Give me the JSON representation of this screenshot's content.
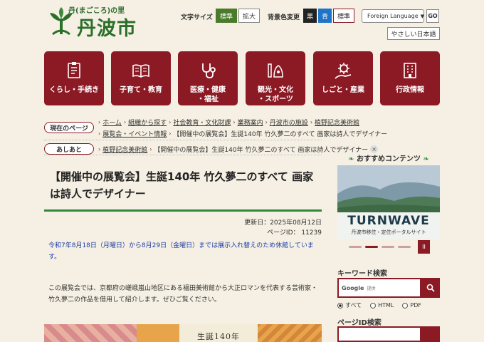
{
  "header": {
    "logo_sub": "丹(まごころ)の里",
    "logo_main": "丹波市",
    "font_size_label": "文字サイズ",
    "font_normal": "標準",
    "font_large": "拡大",
    "bg_label": "背景色変更",
    "bg_black": "黒",
    "bg_blue": "青",
    "bg_normal": "標準",
    "language": "Foreign Language",
    "go": "GO",
    "easy_japanese": "やさしい日本語"
  },
  "nav": [
    {
      "label": "くらし・手続き",
      "icon": "document-icon"
    },
    {
      "label": "子育て・教育",
      "icon": "book-icon"
    },
    {
      "label": "医療・健康\n・福祉",
      "icon": "stethoscope-icon"
    },
    {
      "label": "観光・文化\n・スポーツ",
      "icon": "art-icon"
    },
    {
      "label": "しごと・産業",
      "icon": "gear-hand-icon"
    },
    {
      "label": "行政情報",
      "icon": "building-icon"
    }
  ],
  "breadcrumb": {
    "current_label": "現在のページ",
    "row1": [
      "ホーム",
      "組織から探す",
      "社会教育・文化財課",
      "業務案内",
      "丹波市の施設",
      "植野記念美術館"
    ],
    "row2": [
      "展覧会・イベント情報",
      "【開催中の展覧会】生誕140年 竹久夢二のすべて 画家は詩人でデザイナー"
    ],
    "history_label": "あしあと",
    "history": [
      "植野記念美術館",
      "【開催中の展覧会】生誕140年 竹久夢二のすべて 画家は詩人でデザイナー"
    ],
    "close": "×"
  },
  "article": {
    "title": "【開催中の展覧会】生誕140年 竹久夢二のすべて 画家は詩人でデザイナー",
    "updated": "更新日：2025年08月12日",
    "page_id": "ページID： 11239",
    "notice": "令和7年8月18日（月曜日）から8月29日（金曜日）までは展示入れ替えのため休館しています。",
    "body": "この展覧会では、京都府の嵯峨嵐山地区にある福田美術館から大正ロマンを代表する芸術家・竹久夢二の作品を借用して紹介します。ぜひご覧ください。",
    "banner_text": "生誕140年"
  },
  "sidebar": {
    "recommended_title": "おすすめコンテンツ",
    "banner_brand": "TURNWAVE",
    "banner_caption": "丹波市移住・定住ポータルサイト",
    "pause": "II",
    "keyword_title": "キーワード検索",
    "google_label": "Google",
    "google_sub": "提供",
    "radio": [
      "すべて",
      "HTML",
      "PDF"
    ],
    "page_id_title": "ページID検索"
  },
  "colors": {
    "accent": "#8b1a24",
    "green": "#2e8a3a",
    "background": "#f5f0e3",
    "link_blue": "#1e3ca8"
  }
}
